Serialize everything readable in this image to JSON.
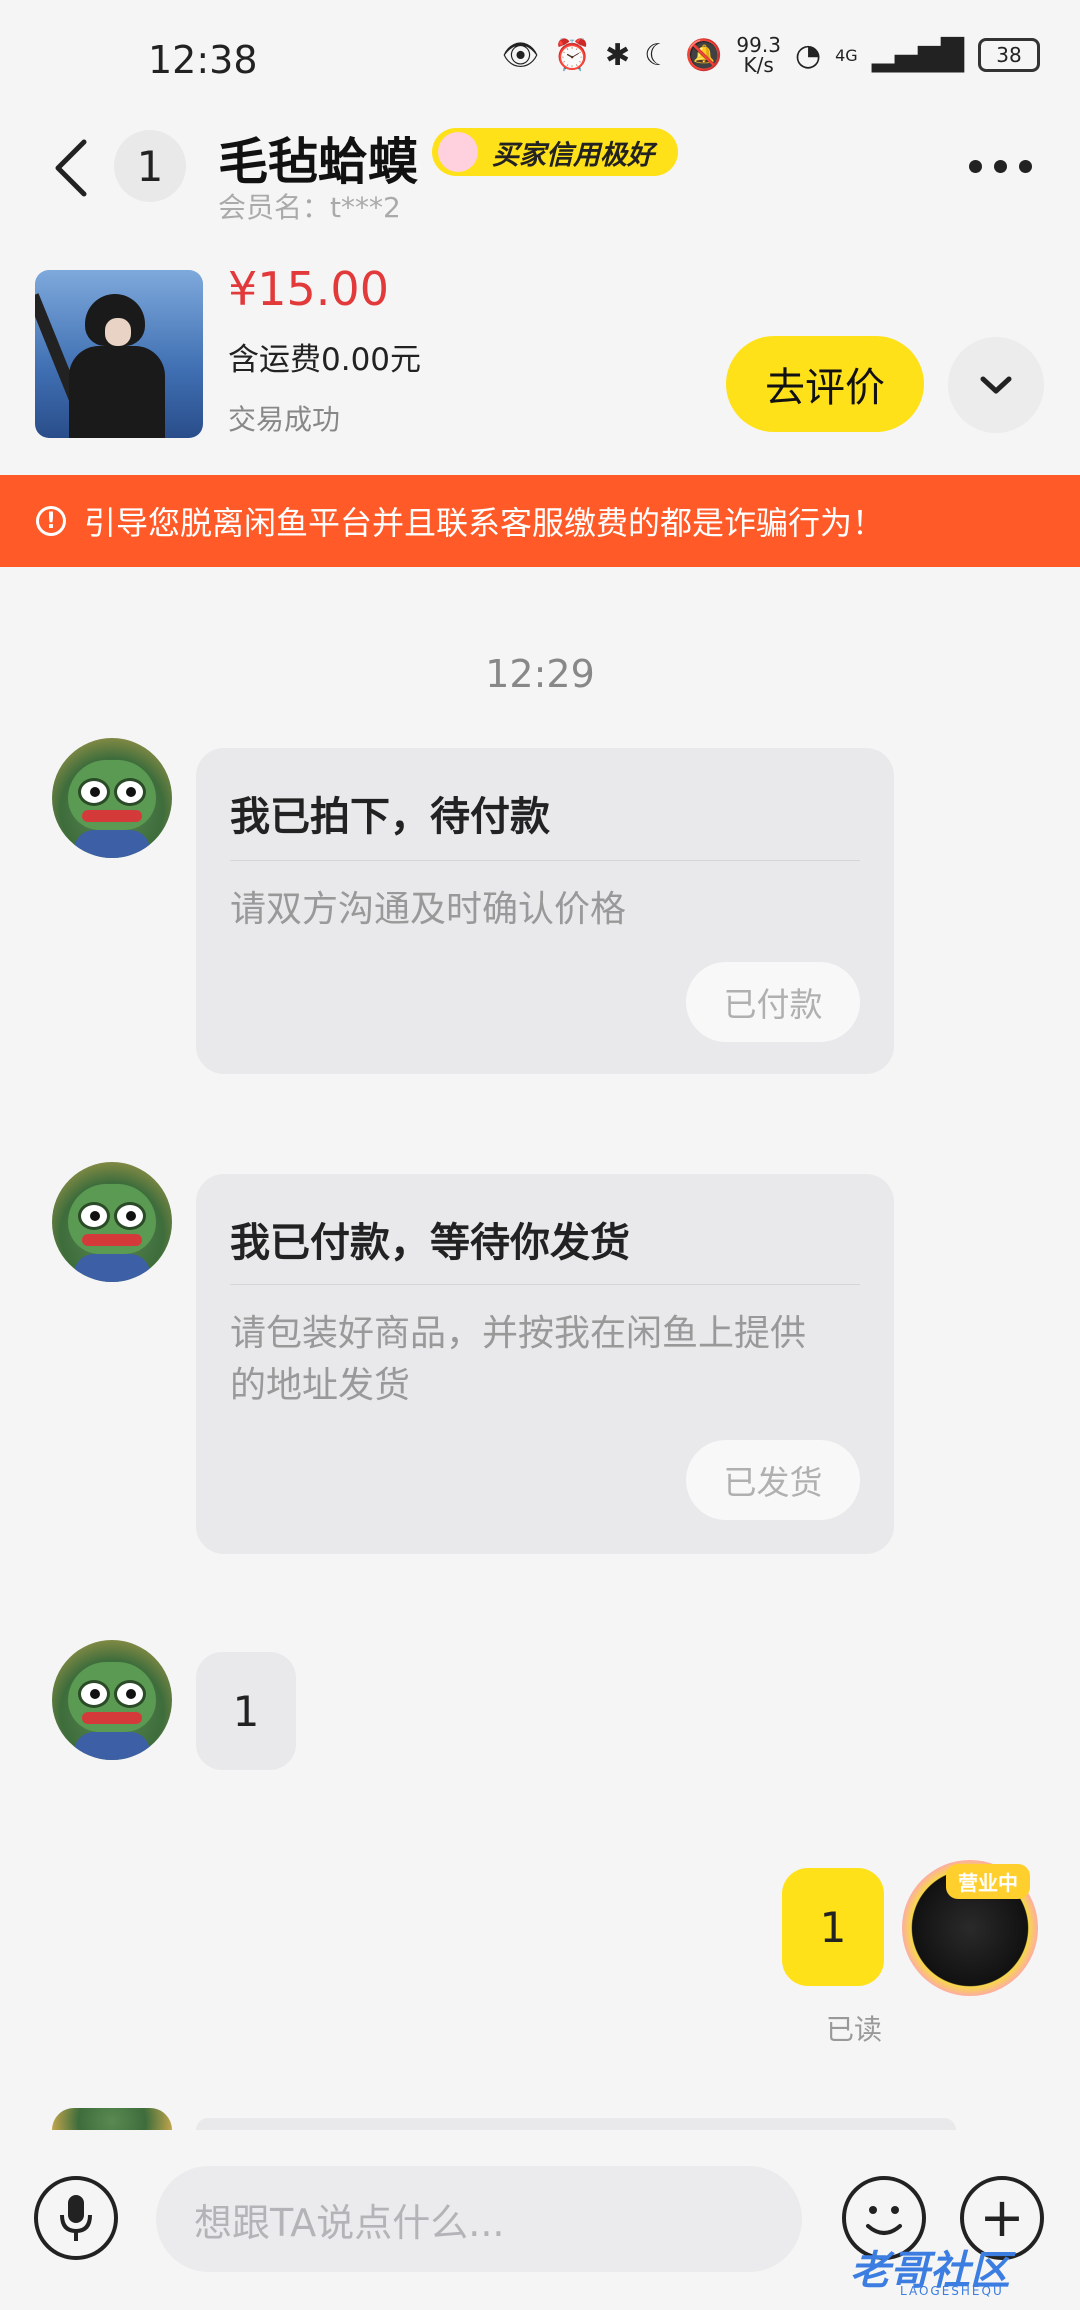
{
  "status_bar": {
    "time": "12:38",
    "net_speed_value": "99.3",
    "net_speed_unit": "K/s",
    "network": "4G",
    "battery": "38"
  },
  "header": {
    "unread_count": "1",
    "seller_name": "毛毡蛤蟆",
    "credit_badge": "买家信用极好",
    "member_label": "会员名：t***2"
  },
  "product": {
    "price": "¥15.00",
    "shipping": "含运费0.00元",
    "status": "交易成功",
    "review_button": "去评价"
  },
  "warning": {
    "text": "引导您脱离闲鱼平台并且联系客服缴费的都是诈骗行为！"
  },
  "chat": {
    "timestamp": "12:29",
    "messages": [
      {
        "title": "我已拍下，待付款",
        "body": "请双方沟通及时确认价格",
        "button": "已付款"
      },
      {
        "title": "我已付款，等待你发货",
        "body": "请包装好商品，并按我在闲鱼上提供的地址发货",
        "button": "已发货"
      },
      {
        "text": "1"
      }
    ],
    "my_message": {
      "text": "1",
      "read": "已读"
    },
    "my_avatar_tag": "营业中"
  },
  "input_bar": {
    "placeholder": "想跟TA说点什么..."
  },
  "watermark": {
    "main": "老哥社区",
    "sub": "LAOGESHEQU"
  },
  "colors": {
    "accent_yellow": "#ffe11a",
    "warning_orange": "#ff5a27",
    "price_red": "#e23a3a"
  }
}
